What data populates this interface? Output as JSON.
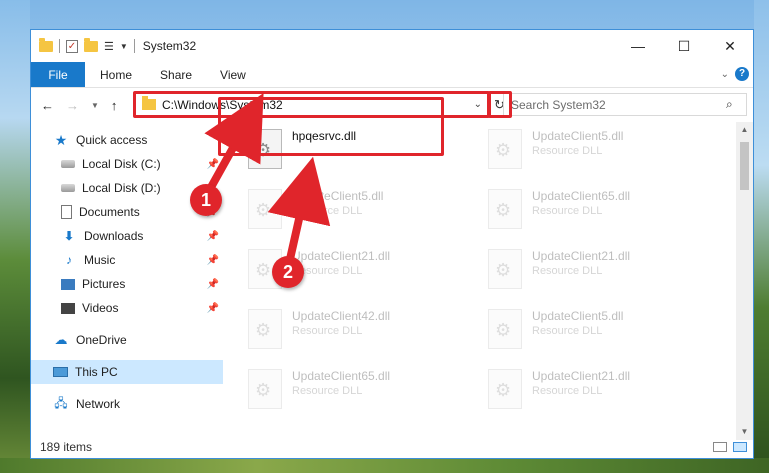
{
  "window": {
    "title": "System32",
    "controls": {
      "minimize": "—",
      "maximize": "☐",
      "close": "✕"
    }
  },
  "ribbon": {
    "file": "File",
    "tabs": [
      "Home",
      "Share",
      "View"
    ]
  },
  "address": {
    "path": "C:\\Windows\\System32",
    "search_placeholder": "Search System32"
  },
  "nav_pane": {
    "quick_access": "Quick access",
    "items": [
      {
        "label": "Local Disk (C:)",
        "icon": "drive-icon",
        "pinned": true
      },
      {
        "label": "Local Disk (D:)",
        "icon": "drive-icon",
        "pinned": false
      },
      {
        "label": "Documents",
        "icon": "documents-icon",
        "pinned": true
      },
      {
        "label": "Downloads",
        "icon": "downloads-icon",
        "pinned": true
      },
      {
        "label": "Music",
        "icon": "music-icon",
        "pinned": true
      },
      {
        "label": "Pictures",
        "icon": "pictures-icon",
        "pinned": true
      },
      {
        "label": "Videos",
        "icon": "videos-icon",
        "pinned": true
      }
    ],
    "onedrive": "OneDrive",
    "this_pc": "This PC",
    "network": "Network"
  },
  "files": [
    {
      "name": "hpqesrvc.dll",
      "type": ""
    },
    {
      "name": "UpdateClient5.dll",
      "type": "Resource DLL"
    },
    {
      "name": "UpdateClient5.dll",
      "type": "Resource DLL"
    },
    {
      "name": "UpdateClient65.dll",
      "type": "Resource DLL"
    },
    {
      "name": "UpdateClient21.dll",
      "type": "Resource DLL"
    },
    {
      "name": "UpdateClient21.dll",
      "type": "Resource DLL"
    },
    {
      "name": "UpdateClient42.dll",
      "type": "Resource DLL"
    },
    {
      "name": "UpdateClient5.dll",
      "type": "Resource DLL"
    },
    {
      "name": "UpdateClient65.dll",
      "type": "Resource DLL"
    },
    {
      "name": "UpdateClient21.dll",
      "type": "Resource DLL"
    }
  ],
  "status": {
    "count": "189 items"
  },
  "annotations": {
    "step1": "1",
    "step2": "2"
  },
  "colors": {
    "accent": "#1979ca",
    "highlight": "#e0252b",
    "selected": "#cce8ff"
  }
}
